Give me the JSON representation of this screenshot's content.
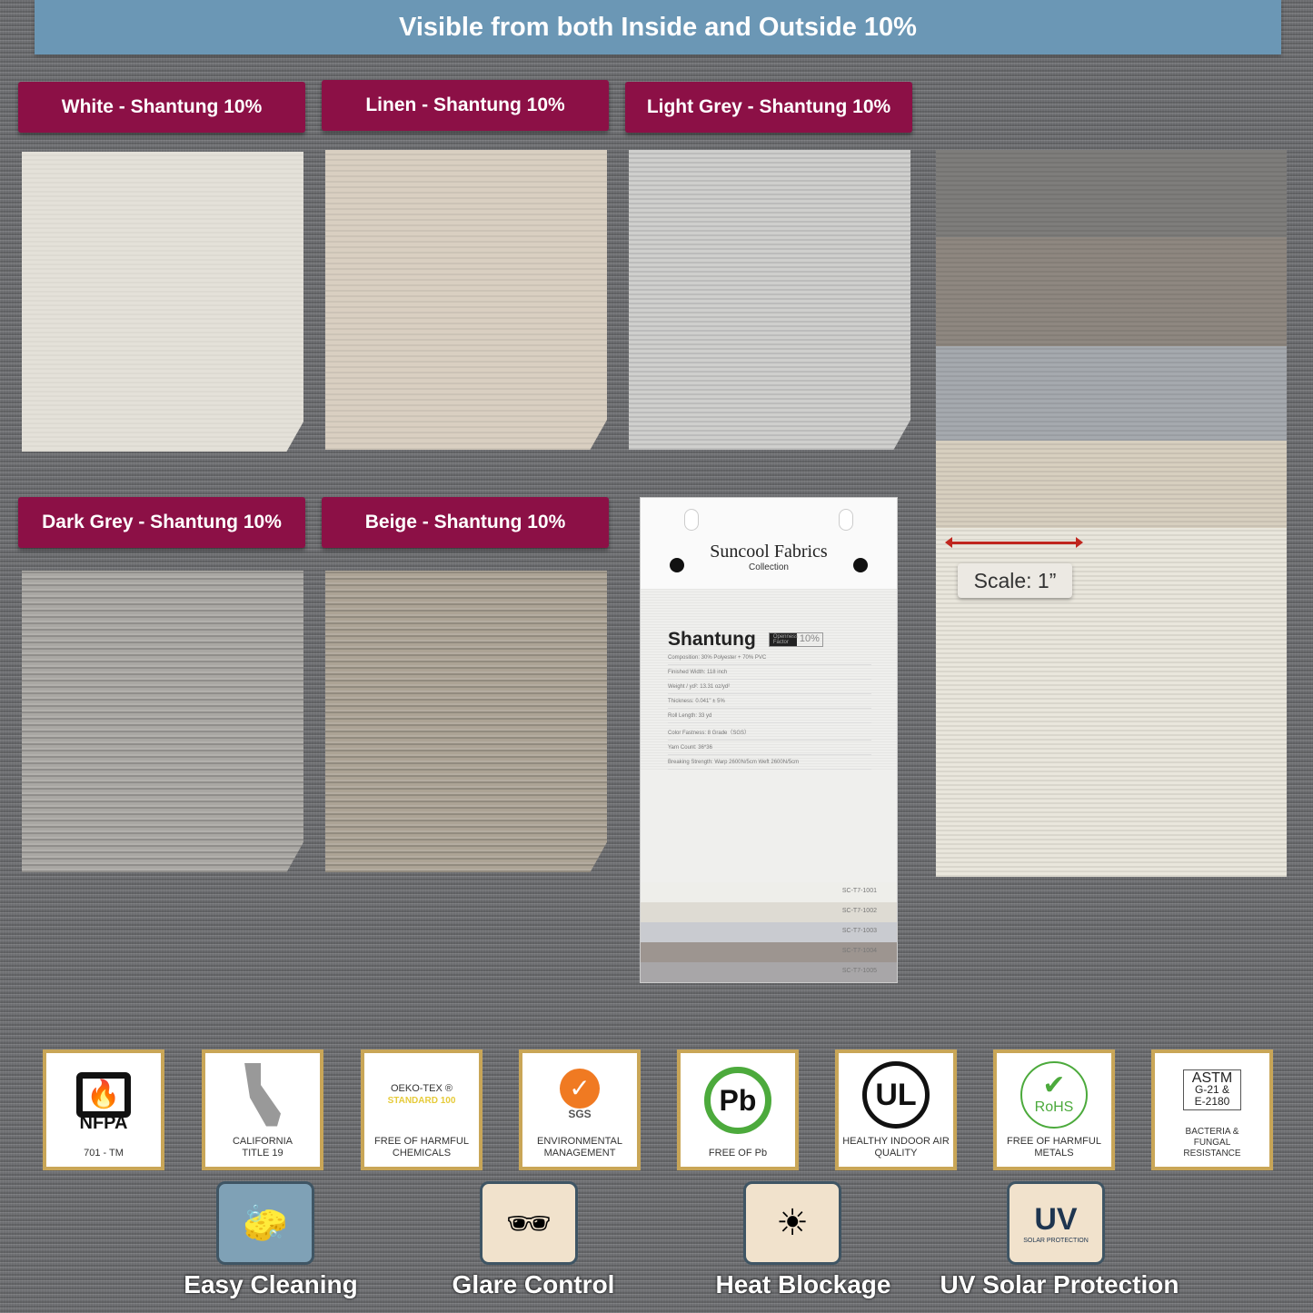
{
  "banner": "Visible from both Inside and Outside 10%",
  "swatches": [
    {
      "label": "White - Shantung 10%",
      "color": "#e4e1d9"
    },
    {
      "label": "Linen - Shantung 10%",
      "color": "#d9cfc1"
    },
    {
      "label": "Light Grey - Shantung 10%",
      "color": "#cfcfcd"
    },
    {
      "label": "Dark Grey - Shantung 10%",
      "color": "#a9a7a3"
    },
    {
      "label": "Beige - Shantung 10%",
      "color": "#aca395"
    }
  ],
  "scale": "Scale: 1”",
  "card": {
    "brand": "Suncool Fabrics",
    "collection": "Collection",
    "title": "Shantung",
    "tag_label": "Openness Factor",
    "tag_value": "10%",
    "specs": [
      "Composition: 30% Polyester + 70% PVC",
      "Finished Width: 118 inch",
      "Weight / yd²: 13.31 oz/yd²",
      "Thickness: 0.041\" ± 5%",
      "Roll Length: 33 yd",
      "Color Fastness: 8 Grade（SGS）",
      "Yarn Count: 36*36",
      "Breaking Strength: Warp 2600N/5cm Weft 2600N/5cm"
    ],
    "codes": [
      "SC-T7-1001",
      "SC-T7-1002",
      "SC-T7-1003",
      "SC-T7-1004",
      "SC-T7-1005"
    ]
  },
  "badges": [
    {
      "logo": "NFPA",
      "text": "701 - TM",
      "icon": "flame-icon"
    },
    {
      "logo": "",
      "text": "CALIFORNIA TITLE 19",
      "icon": "california-map-icon"
    },
    {
      "logo": "OEKO-TEX ®",
      "sub": "STANDARD 100",
      "text": "FREE OF HARMFUL CHEMICALS",
      "icon": "oeko-tex-icon"
    },
    {
      "logo": "SGS",
      "text": "ENVIRONMENTAL MANAGEMENT",
      "icon": "sgs-check-icon"
    },
    {
      "logo": "Pb",
      "text": "FREE OF Pb",
      "icon": "no-lead-icon"
    },
    {
      "logo": "UL",
      "text": "HEALTHY INDOOR AIR QUALITY",
      "icon": "ul-icon"
    },
    {
      "logo": "RoHS",
      "text": "FREE OF HARMFUL METALS",
      "icon": "rohs-check-icon"
    },
    {
      "logo": "ASTM",
      "sub": "G-21 & E-2180",
      "text": "BACTERIA & FUNGAL RESISTANCE",
      "icon": "astm-icon"
    }
  ],
  "features": [
    {
      "label": "Easy Cleaning",
      "icon": "sponge-icon"
    },
    {
      "label": "Glare Control",
      "icon": "sunglasses-shade-icon"
    },
    {
      "label": "Heat Blockage",
      "icon": "sun-shade-icon"
    },
    {
      "label": "UV Solar Protection",
      "icon": "uv-shade-icon",
      "icon_text": "UV",
      "icon_sub": "SOLAR PROTECTION"
    }
  ]
}
